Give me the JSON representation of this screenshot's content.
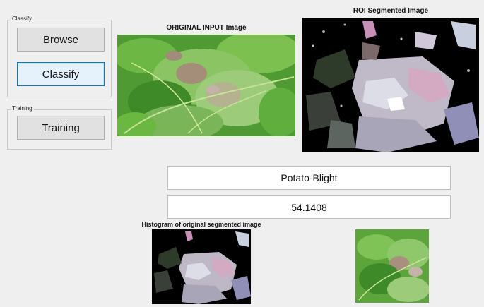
{
  "classify_panel": {
    "title": "Classify",
    "browse_label": "Browse",
    "classify_label": "Classify"
  },
  "training_panel": {
    "title": "Training",
    "training_label": "Training"
  },
  "original_axes": {
    "title": "ORIGINAL INPUT Image"
  },
  "roi_axes": {
    "title": "ROI Segmented Image"
  },
  "histogram_axes": {
    "title": "Histogram of original segmented image"
  },
  "results": {
    "disease": "Potato-Blight",
    "score": "54.1408"
  },
  "colors": {
    "window_bg": "#efefef",
    "button_bg": "#e1e1e1",
    "focus_border": "#0078d7",
    "leaf_green": "#5aa83a",
    "segmented_bg": "#000000"
  }
}
